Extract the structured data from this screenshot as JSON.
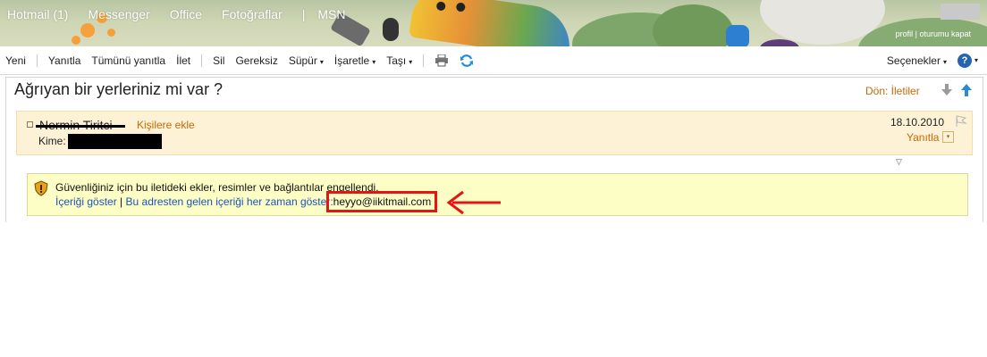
{
  "nav": {
    "hotmail": "Hotmail (1)",
    "messenger": "Messenger",
    "office": "Office",
    "photos": "Fotoğraflar",
    "separator": "|",
    "msn": "MSN"
  },
  "account_links": {
    "profile": "profil",
    "separator": "|",
    "signout": "oturumu kapat"
  },
  "toolbar": {
    "new": "Yeni",
    "reply": "Yanıtla",
    "reply_all": "Tümünü yanıtla",
    "forward": "İlet",
    "delete": "Sil",
    "junk": "Gereksiz",
    "sweep": "Süpür",
    "mark": "İşaretle",
    "move": "Taşı",
    "options": "Seçenekler",
    "help_glyph": "?",
    "caret": "▾"
  },
  "message": {
    "subject": "Ağrıyan bir yerleriniz mi var ?",
    "back_link": "Dön: İletiler",
    "sender_name": "Nermin Tiritci",
    "add_contact": "Kişilere ekle",
    "to_label": "Kime:",
    "date": "18.10.2010",
    "reply": "Yanıtla",
    "reply_dropdown_glyph": "▾",
    "collapse_glyph": "▽"
  },
  "security_notice": {
    "text": "Güvenliğiniz için bu iletideki ekler, resimler ve bağlantılar engellendi.",
    "show_content": "İçeriği göster",
    "separator": "|",
    "always_show": "Bu adresten gelen içeriği her zaman göster:",
    "email": "heyyo@iikitmail.com"
  },
  "colors": {
    "accent_orange": "#c46a07",
    "link_blue": "#1a55b5",
    "header_bg": "#fdf1d6",
    "notice_bg": "#fdfdc6",
    "annotation_red": "#e31515"
  }
}
